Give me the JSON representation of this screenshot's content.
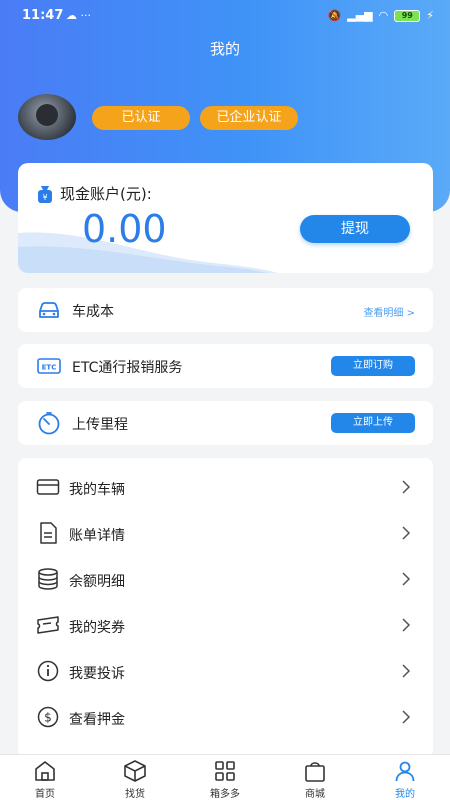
{
  "status_bar": {
    "time": "11:47",
    "battery": "99"
  },
  "header": {
    "title": "我的"
  },
  "profile": {
    "badges": [
      "已认证",
      "已企业认证"
    ]
  },
  "cash_account": {
    "label": "现金账户(元):",
    "amount": "0.00",
    "withdraw_label": "提现"
  },
  "rows": [
    {
      "label": "车成本",
      "action": "查看明细 >",
      "icon": "car-icon"
    },
    {
      "label": "ETC通行报销服务",
      "action": "立即订购",
      "icon": "etc-icon"
    },
    {
      "label": "上传里程",
      "action": "立即上传",
      "icon": "timer-icon"
    }
  ],
  "menu": [
    {
      "label": "我的车辆",
      "icon": "card-icon"
    },
    {
      "label": "账单详情",
      "icon": "document-icon"
    },
    {
      "label": "余额明细",
      "icon": "coins-icon"
    },
    {
      "label": "我的奖券",
      "icon": "ticket-icon"
    },
    {
      "label": "我要投诉",
      "icon": "info-icon"
    },
    {
      "label": "查看押金",
      "icon": "dollar-icon"
    }
  ],
  "tabbar": [
    {
      "label": "首页",
      "icon": "home-icon"
    },
    {
      "label": "找货",
      "icon": "box-icon"
    },
    {
      "label": "箱多多",
      "icon": "grid-icon"
    },
    {
      "label": "商城",
      "icon": "bag-icon"
    },
    {
      "label": "我的",
      "icon": "user-icon",
      "active": true
    }
  ],
  "colors": {
    "primary": "#2387ea",
    "badge": "#f5a31a",
    "header_start": "#4a7cf6",
    "header_end": "#5aaaf8"
  }
}
